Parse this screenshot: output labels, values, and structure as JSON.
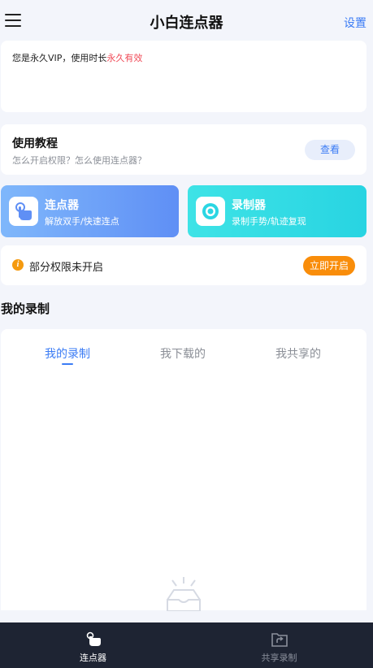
{
  "header": {
    "title": "小白连点器",
    "settings_label": "设置"
  },
  "vip": {
    "text_prefix": "您是永久VIP，使用时长",
    "text_highlight": "永久有效"
  },
  "tutorial": {
    "title": "使用教程",
    "subtitle": "怎么开启权限？怎么使用连点器？",
    "view_label": "查看"
  },
  "features": [
    {
      "title": "连点器",
      "subtitle": "解放双手/快速连点",
      "icon": "hand-tap-icon"
    },
    {
      "title": "录制器",
      "subtitle": "录制手势/轨迹复现",
      "icon": "record-icon"
    }
  ],
  "permission": {
    "text": "部分权限未开启",
    "button_label": "立即开启",
    "icon": "info-icon"
  },
  "records": {
    "section_title": "我的录制",
    "tabs": [
      {
        "label": "我的录制",
        "active": true
      },
      {
        "label": "我下载的",
        "active": false
      },
      {
        "label": "我共享的",
        "active": false
      }
    ]
  },
  "bottom_nav": [
    {
      "label": "连点器",
      "icon": "hand-tap-icon",
      "active": true
    },
    {
      "label": "共享录制",
      "icon": "share-folder-icon",
      "active": false
    }
  ],
  "colors": {
    "accent": "#3b7cf5",
    "highlight_red": "#f04a57",
    "orange": "#f98d0a",
    "nav_bg": "#1e2433"
  }
}
